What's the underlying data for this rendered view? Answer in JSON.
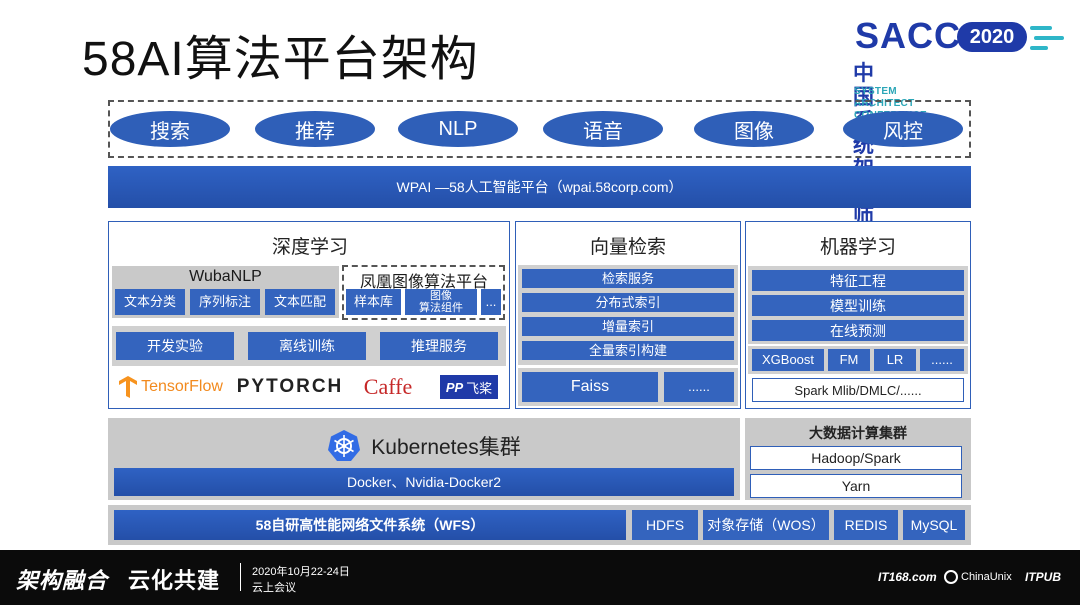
{
  "title": "58AI算法平台架构",
  "logo": {
    "sacc": "SACC",
    "year": "2020",
    "cn": "中国系统架构师大会",
    "en": "SYSTEM ARCHITECT CONFERENCE CHINA"
  },
  "apps": [
    "搜索",
    "推荐",
    "NLP",
    "语音",
    "图像",
    "风控"
  ],
  "wpai": "WPAI —58人工智能平台（wpai.58corp.com）",
  "deep_learning": {
    "title": "深度学习",
    "wubanlp": {
      "title": "WubaNLP",
      "items": [
        "文本分类",
        "序列标注",
        "文本匹配"
      ]
    },
    "phoenix": {
      "title": "凤凰图像算法平台",
      "items": [
        "样本库",
        "图像\n算法组件",
        "..."
      ]
    },
    "services": [
      "开发实验",
      "离线训练",
      "推理服务"
    ],
    "frameworks": [
      "TensorFlow",
      "PYTORCH",
      "Caffe",
      "飞桨"
    ]
  },
  "vector_search": {
    "title": "向量检索",
    "items": [
      "检索服务",
      "分布式索引",
      "增量索引",
      "全量索引构建"
    ],
    "bottom": [
      "Faiss",
      "......"
    ]
  },
  "machine_learning": {
    "title": "机器学习",
    "items": [
      "特征工程",
      "模型训练",
      "在线预测"
    ],
    "algos": [
      "XGBoost",
      "FM",
      "LR",
      "......"
    ],
    "spark": "Spark Mlib/DMLC/......"
  },
  "k8s": {
    "title": "Kubernetes集群",
    "docker": "Docker、Nvidia-Docker2"
  },
  "bigdata": {
    "title": "大数据计算集群",
    "items": [
      "Hadoop/Spark",
      "Yarn"
    ]
  },
  "storage": [
    "58自研高性能网络文件系统（WFS）",
    "HDFS",
    "对象存储（WOS）",
    "REDIS",
    "MySQL"
  ],
  "footer": {
    "brand1": "架构融合",
    "brand2": "云化共建",
    "date": "2020年10月22-24日",
    "venue": "云上会议",
    "sponsors": [
      "IT168.com",
      "ChinaUnix",
      "ITPUB"
    ]
  },
  "colors": {
    "primary": "#2f5fb8",
    "gray": "#c9c9c9",
    "teal": "#2eb6c8"
  }
}
